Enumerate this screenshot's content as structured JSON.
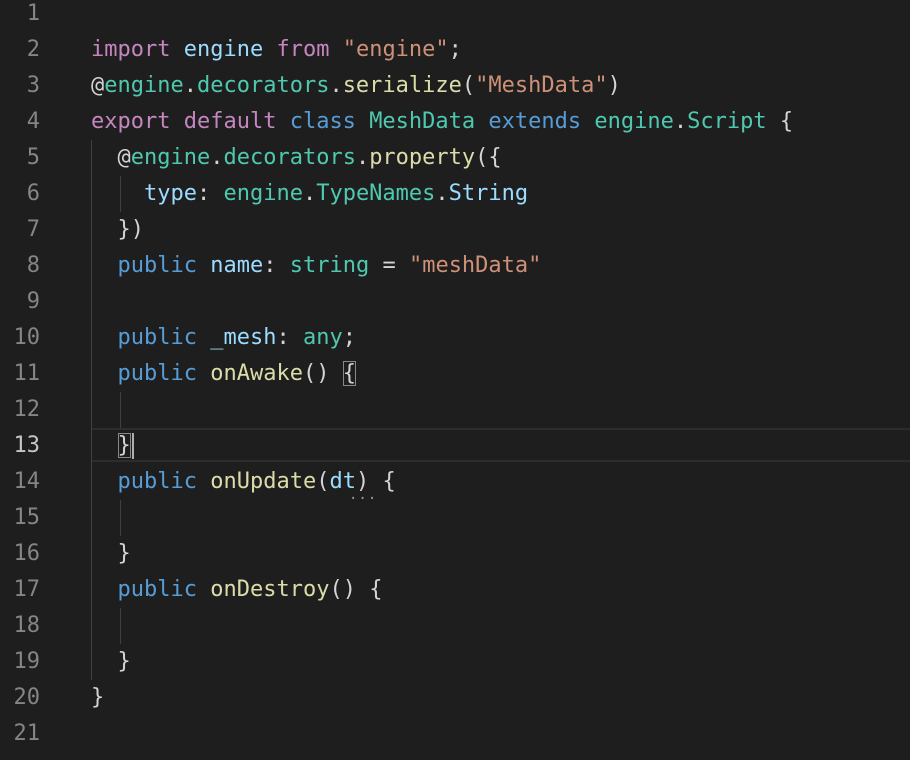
{
  "editor": {
    "active_line": "13",
    "lines": [
      {
        "num": "1",
        "text": ""
      },
      {
        "num": "2",
        "text": "import engine from \"engine\";"
      },
      {
        "num": "3",
        "text": "@engine.decorators.serialize(\"MeshData\")"
      },
      {
        "num": "4",
        "text": "export default class MeshData extends engine.Script {"
      },
      {
        "num": "5",
        "text": "  @engine.decorators.property({"
      },
      {
        "num": "6",
        "text": "    type: engine.TypeNames.String"
      },
      {
        "num": "7",
        "text": "  })"
      },
      {
        "num": "8",
        "text": "  public name: string = \"meshData\""
      },
      {
        "num": "9",
        "text": ""
      },
      {
        "num": "10",
        "text": "  public _mesh: any;"
      },
      {
        "num": "11",
        "text": "  public onAwake() {"
      },
      {
        "num": "12",
        "text": ""
      },
      {
        "num": "13",
        "text": "  }"
      },
      {
        "num": "14",
        "text": "  public onUpdate(dt) {"
      },
      {
        "num": "15",
        "text": ""
      },
      {
        "num": "16",
        "text": "  }"
      },
      {
        "num": "17",
        "text": "  public onDestroy() {"
      },
      {
        "num": "18",
        "text": ""
      },
      {
        "num": "19",
        "text": "  }"
      },
      {
        "num": "20",
        "text": "}"
      },
      {
        "num": "21",
        "text": ""
      }
    ],
    "colors": {
      "background": "#1e1e1e",
      "keyword_control": "#c586c0",
      "keyword_storage": "#569cd6",
      "variable": "#9cdcfe",
      "type": "#4ec9b0",
      "string": "#ce9178",
      "function": "#dcdcaa",
      "plain": "#d4d4d4",
      "line_number": "#858585",
      "line_number_active": "#c6c6c6"
    }
  }
}
